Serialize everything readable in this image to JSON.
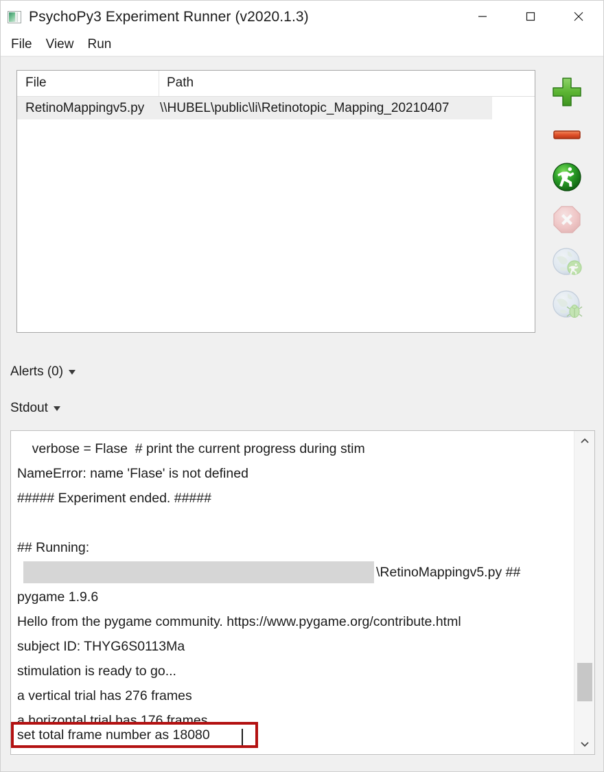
{
  "window": {
    "title": "PsychoPy3 Experiment Runner (v2020.1.3)",
    "icon": "psychopy-app-icon",
    "controls": {
      "minimize": "minimize-icon",
      "maximize": "maximize-icon",
      "close": "close-icon"
    }
  },
  "menu": {
    "items": [
      {
        "label": "File"
      },
      {
        "label": "View"
      },
      {
        "label": "Run"
      }
    ]
  },
  "file_list": {
    "columns": [
      "File",
      "Path"
    ],
    "rows": [
      {
        "file": "RetinoMappingv5.py",
        "path": "\\\\HUBEL\\public\\li\\Retinotopic_Mapping_20210407",
        "selected": true
      }
    ]
  },
  "toolbar": {
    "buttons": [
      {
        "name": "add-experiment-button",
        "icon": "plus-icon",
        "color": "#5cb533",
        "enabled": true
      },
      {
        "name": "remove-experiment-button",
        "icon": "minus-icon",
        "color": "#e0502a",
        "enabled": true
      },
      {
        "name": "run-experiment-button",
        "icon": "run-icon",
        "color": "#2ba028",
        "enabled": true
      },
      {
        "name": "stop-experiment-button",
        "icon": "stop-icon",
        "color": "#e8a0a0",
        "enabled": false
      },
      {
        "name": "run-online-button",
        "icon": "globe-run-icon",
        "color": "#b9cbe0",
        "enabled": false
      },
      {
        "name": "debug-online-button",
        "icon": "globe-debug-icon",
        "color": "#b9cbe0",
        "enabled": false
      }
    ]
  },
  "panels": {
    "alerts": {
      "label": "Alerts (0)",
      "count": 0,
      "caret": "chevron-down-icon"
    },
    "stdout": {
      "label": "Stdout",
      "caret": "chevron-down-icon"
    }
  },
  "console": {
    "lines": [
      "    verbose = Flase  # print the current progress during stim",
      "NameError: name 'Flase' is not defined",
      "##### Experiment ended. #####",
      "",
      "## Running:"
    ],
    "redacted_line": {
      "redacted": true,
      "tail": "\\RetinoMappingv5.py ##"
    },
    "lines_after": [
      "pygame 1.9.6",
      "Hello from the pygame community. https://www.pygame.org/contribute.html",
      "subject ID: THYG6S0113Ma",
      "stimulation is ready to go...",
      "a vertical trial has 276 frames",
      "a horizontal trial has 176 frames"
    ],
    "highlighted_line": "set total frame number as 18080",
    "highlight_color": "#b31111",
    "scrollbar": {
      "up_arrow": "chevron-up-icon",
      "down_arrow": "chevron-down-icon",
      "thumb": "scrollbar-thumb"
    }
  }
}
